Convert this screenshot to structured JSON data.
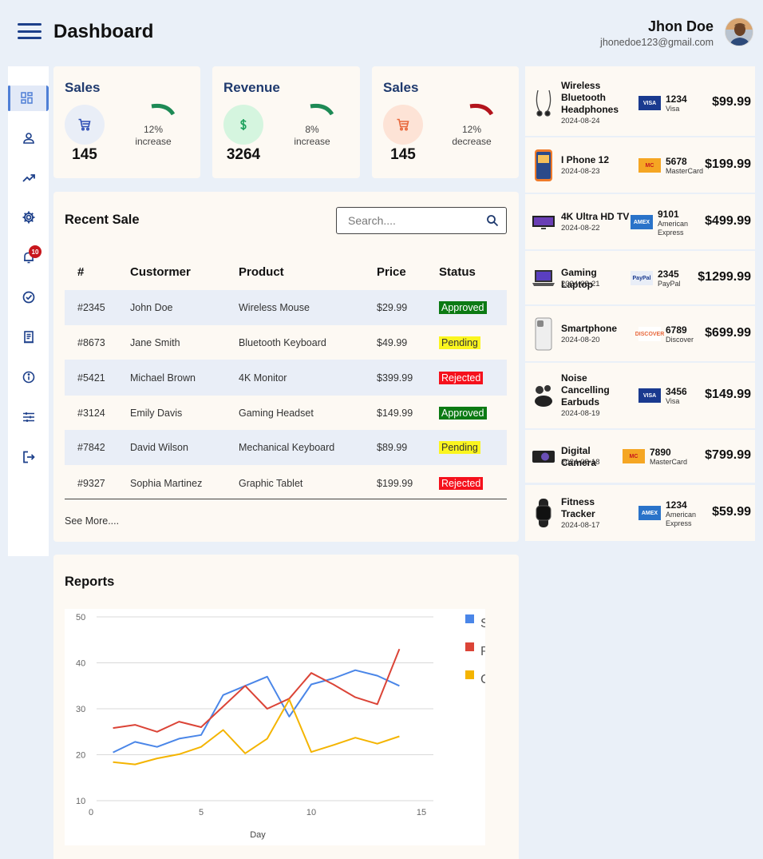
{
  "header": {
    "title": "Dashboard",
    "user_name": "Jhon Doe",
    "user_email": "jhonedoe123@gmail.com"
  },
  "sidebar": {
    "items": [
      "dashboard",
      "profile",
      "analytics",
      "settings",
      "notifications",
      "tasks",
      "reports",
      "info",
      "filters",
      "logout"
    ],
    "notification_count": "10"
  },
  "stats": [
    {
      "title": "Sales",
      "value": "145",
      "percent": "12%",
      "trend": "increase",
      "color": "#1d8a55",
      "bg": "#e9eef7",
      "icon": "cart-icon",
      "icon_color": "#2f4fb5"
    },
    {
      "title": "Revenue",
      "value": "3264",
      "percent": "8%",
      "trend": "increase",
      "color": "#1d8a55",
      "bg": "#d5f5df",
      "icon": "dollar-icon",
      "icon_color": "#19a05a"
    },
    {
      "title": "Sales",
      "value": "145",
      "percent": "12%",
      "trend": "decrease",
      "color": "#b3141c",
      "bg": "#fde3d6",
      "icon": "cart-icon",
      "icon_color": "#e8683c"
    }
  ],
  "recent_sale": {
    "title": "Recent Sale",
    "search_placeholder": "Search....",
    "columns": [
      "#",
      "Custormer",
      "Product",
      "Price",
      "Status"
    ],
    "rows": [
      {
        "id": "#2345",
        "customer": "John Doe",
        "product": "Wireless Mouse",
        "price": "$29.99",
        "status": "Approved"
      },
      {
        "id": "#8673",
        "customer": "Jane Smith",
        "product": "Bluetooth Keyboard",
        "price": "$49.99",
        "status": "Pending"
      },
      {
        "id": "#5421",
        "customer": "Michael Brown",
        "product": "4K Monitor",
        "price": "$399.99",
        "status": "Rejected"
      },
      {
        "id": "#3124",
        "customer": "Emily Davis",
        "product": "Gaming Headset",
        "price": "$149.99",
        "status": "Approved"
      },
      {
        "id": "#7842",
        "customer": "David Wilson",
        "product": "Mechanical Keyboard",
        "price": "$89.99",
        "status": "Pending"
      },
      {
        "id": "#9327",
        "customer": "Sophia Martinez",
        "product": "Graphic Tablet",
        "price": "$199.99",
        "status": "Rejected"
      }
    ],
    "see_more": "See More...."
  },
  "reports": {
    "title": "Reports"
  },
  "chart_data": {
    "type": "line",
    "xlabel": "Day",
    "ylabel": "",
    "xlim": [
      0,
      15
    ],
    "ylim": [
      10,
      50
    ],
    "xticks": [
      0,
      5,
      10,
      15
    ],
    "yticks": [
      10,
      20,
      30,
      40,
      50
    ],
    "grid": true,
    "legend_position": "right",
    "legend_labels": [
      "S",
      "R",
      "C"
    ],
    "x": [
      1,
      2,
      3,
      4,
      5,
      6,
      7,
      8,
      9,
      10,
      11,
      12,
      13,
      14
    ],
    "series": [
      {
        "color": "#4a86e8",
        "values": [
          20.5,
          22.8,
          21.7,
          23.5,
          24.3,
          33,
          35,
          37,
          28.3,
          35.3,
          36.6,
          38.4,
          37.2,
          35
        ]
      },
      {
        "color": "#db4437",
        "values": [
          25.8,
          26.5,
          25,
          27.2,
          26,
          30.5,
          35,
          30,
          32.2,
          37.8,
          35.3,
          32.5,
          31,
          43
        ]
      },
      {
        "color": "#f4b400",
        "values": [
          18.4,
          17.9,
          19.2,
          20.1,
          21.7,
          25.4,
          20.3,
          23.5,
          32,
          20.6,
          22.1,
          23.7,
          22.4,
          24
        ]
      }
    ]
  },
  "transactions": [
    {
      "name": "Wireless Bluetooth Headphones",
      "date": "2024-08-24",
      "card": "visa",
      "card_number": "1234",
      "card_brand": "Visa",
      "amount": "$99.99",
      "icon": "earbuds-icon"
    },
    {
      "name": "I Phone 12",
      "date": "2024-08-23",
      "card": "mastercard",
      "card_number": "5678",
      "card_brand": "MasterCard",
      "amount": "$199.99",
      "icon": "phone-icon"
    },
    {
      "name": "4K Ultra HD TV",
      "date": "2024-08-22",
      "card": "amex",
      "card_number": "9101",
      "card_brand": "American Express",
      "amount": "$499.99",
      "icon": "tv-icon"
    },
    {
      "name": "Gaming Laptop",
      "date": "2024-08-21",
      "card": "paypal",
      "card_number": "2345",
      "card_brand": "PayPal",
      "amount": "$1299.99",
      "icon": "laptop-icon"
    },
    {
      "name": "Smartphone",
      "date": "2024-08-20",
      "card": "discover",
      "card_number": "6789",
      "card_brand": "Discover",
      "amount": "$699.99",
      "icon": "smartphone-icon"
    },
    {
      "name": "Noise Cancelling Earbuds",
      "date": "2024-08-19",
      "card": "visa",
      "card_number": "3456",
      "card_brand": "Visa",
      "amount": "$149.99",
      "icon": "earbuds-case-icon"
    },
    {
      "name": "Digital Camera",
      "date": "2024-08-18",
      "card": "mastercard",
      "card_number": "7890",
      "card_brand": "MasterCard",
      "amount": "$799.99",
      "icon": "camera-icon"
    },
    {
      "name": "Fitness Tracker",
      "date": "2024-08-17",
      "card": "amex",
      "card_number": "1234",
      "card_brand": "American Express",
      "amount": "$59.99",
      "icon": "watch-icon"
    }
  ],
  "card_labels": {
    "visa": "VISA",
    "mastercard": "MC",
    "amex": "AMEX",
    "paypal": "PayPal",
    "discover": "DISCOVER"
  }
}
